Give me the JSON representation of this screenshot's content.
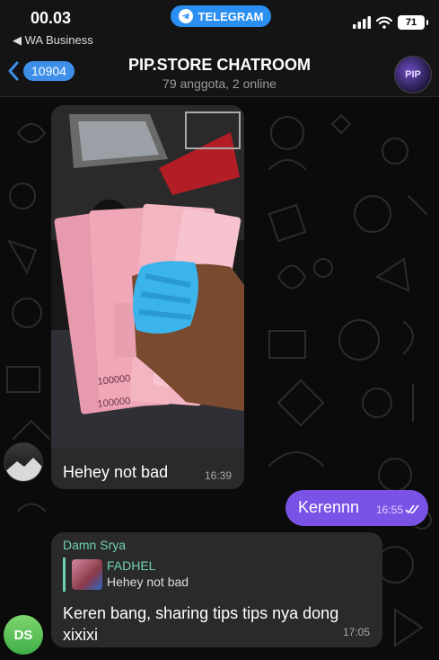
{
  "status_bar": {
    "time": "00.03",
    "back_app": "◀ WA Business",
    "pill_label": "TELEGRAM",
    "battery": "71"
  },
  "header": {
    "unread_count": "10904",
    "title": "PIP.STORE CHATROOM",
    "subtitle": "79 anggota, 2 online",
    "avatar_text": "PIP"
  },
  "messages": [
    {
      "type": "photo",
      "caption": "Hehey not bad",
      "time": "16:39"
    },
    {
      "type": "outgoing",
      "text": "Kerennn",
      "time": "16:55"
    },
    {
      "type": "incoming",
      "sender": "Damn Srya",
      "reply_to": {
        "name": "FADHEL",
        "text": "Hehey not bad"
      },
      "text": "Keren bang, sharing tips tips nya dong xixixi",
      "time": "17:05",
      "avatar_initials": "DS"
    }
  ],
  "photo_content": {
    "banknote_values": [
      "100000",
      "100000"
    ]
  },
  "colors": {
    "outgoing_bubble": "#7a52e6",
    "incoming_bubble": "#2a2a2a",
    "sender_name": "#6fd1b4",
    "accent_blue": "#3d8fe8",
    "avatar_ds": "#5cc45a"
  }
}
